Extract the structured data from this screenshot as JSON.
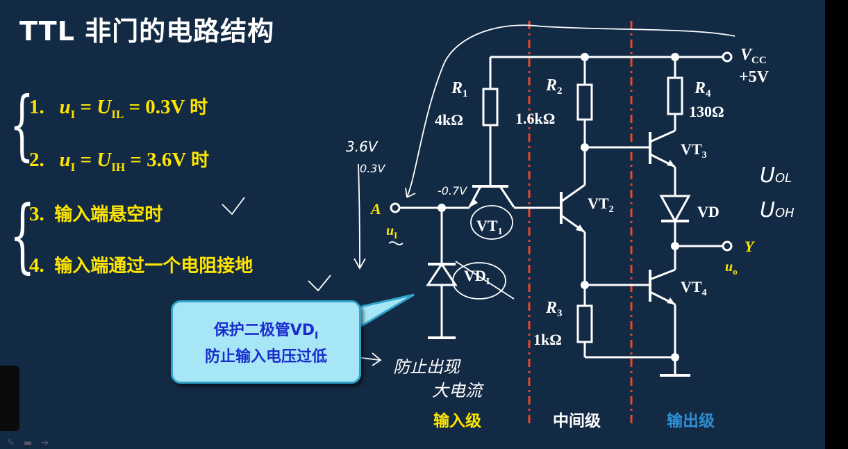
{
  "title": "TTL 非门的电路结构",
  "conditions": [
    {
      "num": "1.",
      "var": "u",
      "sub": "I",
      "eq": "=",
      "var2": "U",
      "sub2": "IL",
      "val": "= 0.3V",
      "suffix": "时"
    },
    {
      "num": "2.",
      "var": "u",
      "sub": "I",
      "eq": "=",
      "var2": "U",
      "sub2": "IH",
      "val": "= 3.6V",
      "suffix": "时"
    },
    {
      "num": "3.",
      "text": "输入端悬空时"
    },
    {
      "num": "4.",
      "text": "输入端通过一个电阻接地"
    }
  ],
  "callout": {
    "line1": "保护二极管VD",
    "line1_sub": "I",
    "line2": "防止输入电压过低"
  },
  "stages": {
    "input": "输入级",
    "middle": "中间级",
    "output": "输出级"
  },
  "circuit": {
    "vcc_label": "V",
    "vcc_sub": "CC",
    "vcc_value": "+5V",
    "r1_name": "R",
    "r1_sub": "1",
    "r1_value": "4kΩ",
    "r2_name": "R",
    "r2_sub": "2",
    "r2_value": "1.6kΩ",
    "r3_name": "R",
    "r3_sub": "3",
    "r3_value": "1kΩ",
    "r4_name": "R",
    "r4_sub": "4",
    "r4_value": "130Ω",
    "vt1": "VT",
    "vt1_sub": "1",
    "vt2": "VT",
    "vt2_sub": "2",
    "vt3": "VT",
    "vt3_sub": "3",
    "vt4": "VT",
    "vt4_sub": "4",
    "vd": "VD",
    "vdi": "VD",
    "vdi_sub": "I",
    "input_label": "A",
    "input_var": "u",
    "input_var_sub": "I",
    "output_label": "Y",
    "output_var": "u",
    "output_var_sub": "o"
  },
  "handwriting": {
    "v36": "3.6V",
    "v03": "0.3V",
    "vneg07": "-0.7V",
    "uol": "U",
    "uol_sub": "OL",
    "uoh": "U",
    "uoh_sub": "OH",
    "note1": "防止出现",
    "note2": "大电流"
  },
  "colors": {
    "background": "#132a44",
    "yellow": "#ffe600",
    "callout_bg": "#a6e6f7",
    "callout_text": "#1a2ccc",
    "divider": "#e8482a",
    "output_stage": "#2f8fd6"
  }
}
